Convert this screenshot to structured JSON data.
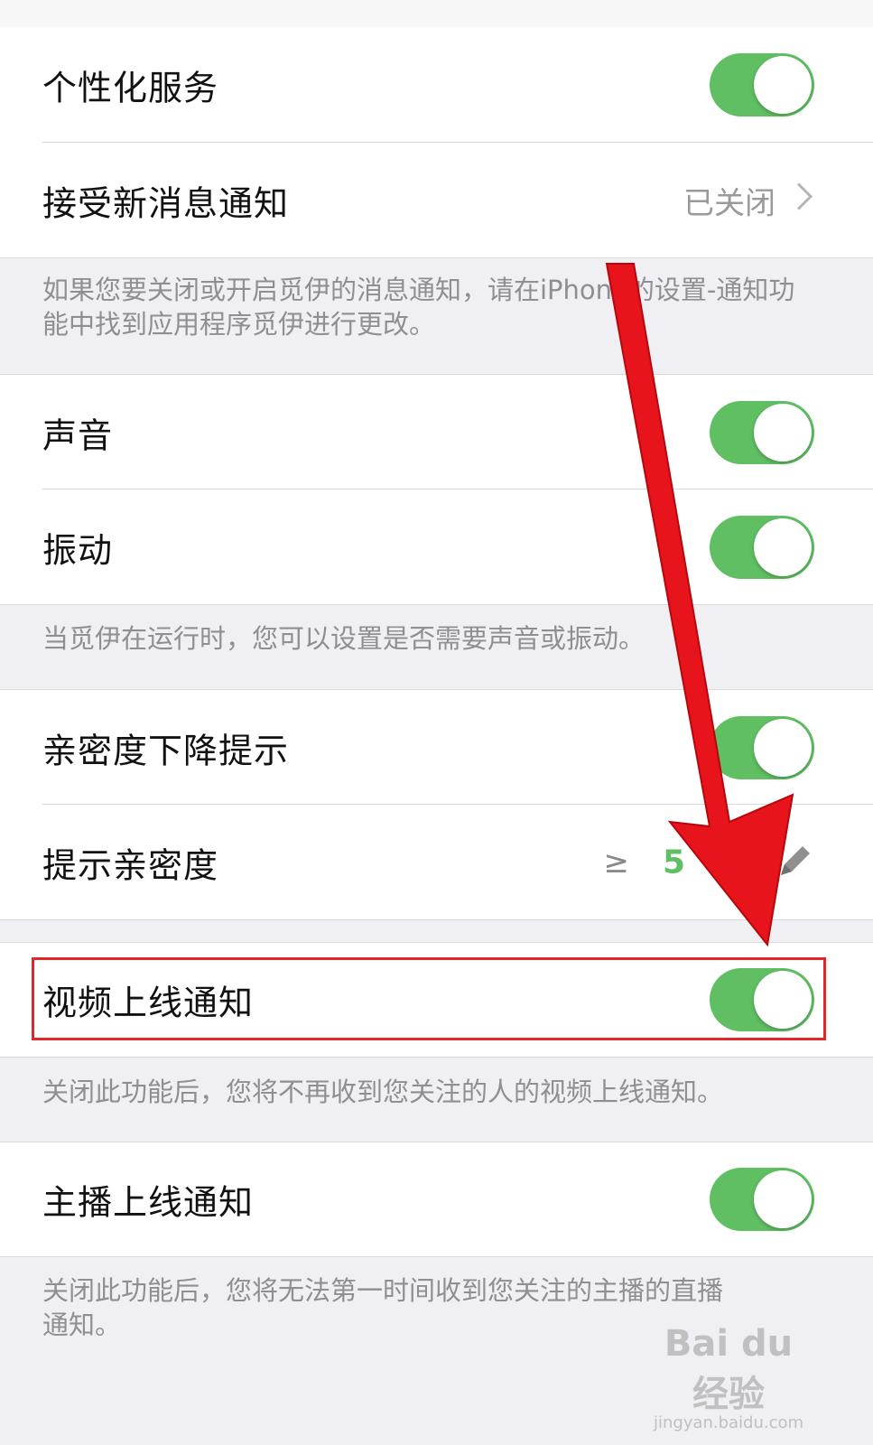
{
  "settings": {
    "personalized_service": {
      "label": "个性化服务",
      "on": true
    },
    "new_message_notify": {
      "label": "接受新消息通知",
      "value": "已关闭"
    },
    "notify_note": "如果您要关闭或开启觅伊的消息通知，请在iPhone的设置-通知功能中找到应用程序觅伊进行更改。",
    "sound": {
      "label": "声音",
      "on": true
    },
    "vibration": {
      "label": "振动",
      "on": true
    },
    "sound_note": "当觅伊在运行时，您可以设置是否需要声音或振动。",
    "intimacy_drop": {
      "label": "亲密度下降提示",
      "on": true
    },
    "intimacy_threshold": {
      "label": "提示亲密度",
      "operator": "≥",
      "value": "5"
    },
    "video_online": {
      "label": "视频上线通知",
      "on": true
    },
    "video_note": "关闭此功能后，您将不再收到您关注的人的视频上线通知。",
    "anchor_online": {
      "label": "主播上线通知",
      "on": true
    },
    "anchor_note": "关闭此功能后，您将无法第一时间收到您关注的主播的直播通知。"
  },
  "watermark": {
    "brand": "Bai du 经验",
    "site": "jingyan.baidu.com"
  },
  "colors": {
    "toggle_on": "#5fbf62",
    "highlight": "#e3262a",
    "arrow": "#e8141b"
  }
}
